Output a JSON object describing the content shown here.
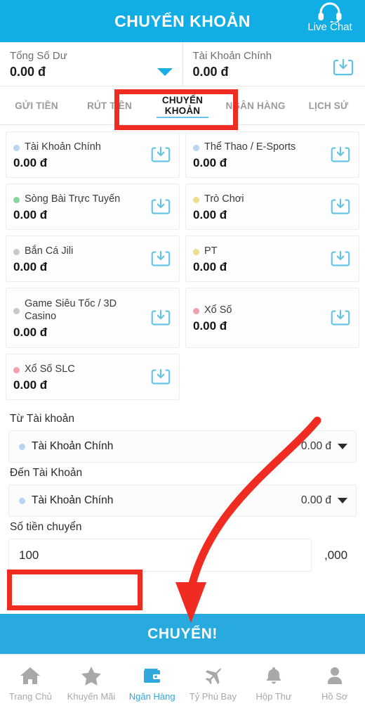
{
  "header": {
    "title": "CHUYỂN KHOẢN",
    "live_chat_label": "Live Chat",
    "live_chat_icon": "headset-icon"
  },
  "balance_bar": {
    "total": {
      "label": "Tổng Số Dư",
      "amount": "0.00 đ",
      "caret_icon": "caret-down-icon"
    },
    "main": {
      "label": "Tài Khoản Chính",
      "amount": "0.00 đ",
      "action_icon": "download-tray-icon"
    }
  },
  "tabs": [
    {
      "label": "GỬI TIỀN",
      "active": false
    },
    {
      "label": "RÚT TIỀN",
      "active": false
    },
    {
      "label": "CHUYỂN KHOẢN",
      "active": true
    },
    {
      "label": "NGÂN HÀNG",
      "active": false
    },
    {
      "label": "LỊCH SỬ",
      "active": false
    }
  ],
  "wallet_cards": [
    {
      "name": "Tài Khoản Chính",
      "amount": "0.00 đ",
      "dot_color": "#B9D4F2",
      "action_icon": "download-tray-icon"
    },
    {
      "name": "Thể Thao / E-Sports",
      "amount": "0.00 đ",
      "dot_color": "#B9D4F2",
      "action_icon": "download-tray-icon"
    },
    {
      "name": "Sòng Bài Trực Tuyến",
      "amount": "0.00 đ",
      "dot_color": "#86D6A0",
      "action_icon": "download-tray-icon"
    },
    {
      "name": "Trò Chơi",
      "amount": "0.00 đ",
      "dot_color": "#EFDD8B",
      "action_icon": "download-tray-icon"
    },
    {
      "name": "Bắn Cá Jili",
      "amount": "0.00 đ",
      "dot_color": "#C9C9C9",
      "action_icon": "download-tray-icon"
    },
    {
      "name": "PT",
      "amount": "0.00 đ",
      "dot_color": "#EFDD8B",
      "action_icon": "download-tray-icon"
    },
    {
      "name": "Game Siêu Tốc / 3D Casino",
      "amount": "0.00 đ",
      "dot_color": "#C9C9C9",
      "action_icon": "download-tray-icon"
    },
    {
      "name": "Xổ Số",
      "amount": "0.00 đ",
      "dot_color": "#F2A0AD",
      "action_icon": "download-tray-icon"
    },
    {
      "name": "Xổ Số SLC",
      "amount": "0.00 đ",
      "dot_color": "#F2A0AD",
      "action_icon": "download-tray-icon"
    }
  ],
  "form": {
    "from_label": "Từ Tài khoản",
    "from_value": "Tài Khoản Chính",
    "from_amount": "0.00 đ",
    "to_label": "Đến Tài Khoản",
    "to_value": "Tài Khoản Chính",
    "to_amount": "0.00 đ",
    "amount_label": "Số tiền chuyển",
    "amount_value": "100",
    "amount_placeholder": "",
    "amount_suffix": ",000",
    "submit_label": "CHUYỂN!"
  },
  "bottom_nav": [
    {
      "label": "Trang Chủ",
      "icon": "home-icon",
      "active": false
    },
    {
      "label": "Khuyến Mãi",
      "icon": "star-icon",
      "active": false
    },
    {
      "label": "Ngân Hàng",
      "icon": "wallet-icon",
      "active": true
    },
    {
      "label": "Tỷ Phú Bay",
      "icon": "plane-icon",
      "active": false
    },
    {
      "label": "Hộp Thư",
      "icon": "bell-icon",
      "active": false
    },
    {
      "label": "Hồ Sơ",
      "icon": "person-icon",
      "active": false
    }
  ],
  "annotations": {
    "highlight_color": "#F02B21",
    "boxes": [
      "tab-chuyen-khoan",
      "amount-input"
    ],
    "arrow": "curved-arrow-to-submit-button"
  },
  "colors": {
    "header_blue": "#11AEE6",
    "submit_blue": "#29AADE",
    "active_nav_blue": "#2FA8DC",
    "tab_underline": "#6CC5E8",
    "icon_blue": "#5FC3E4"
  }
}
